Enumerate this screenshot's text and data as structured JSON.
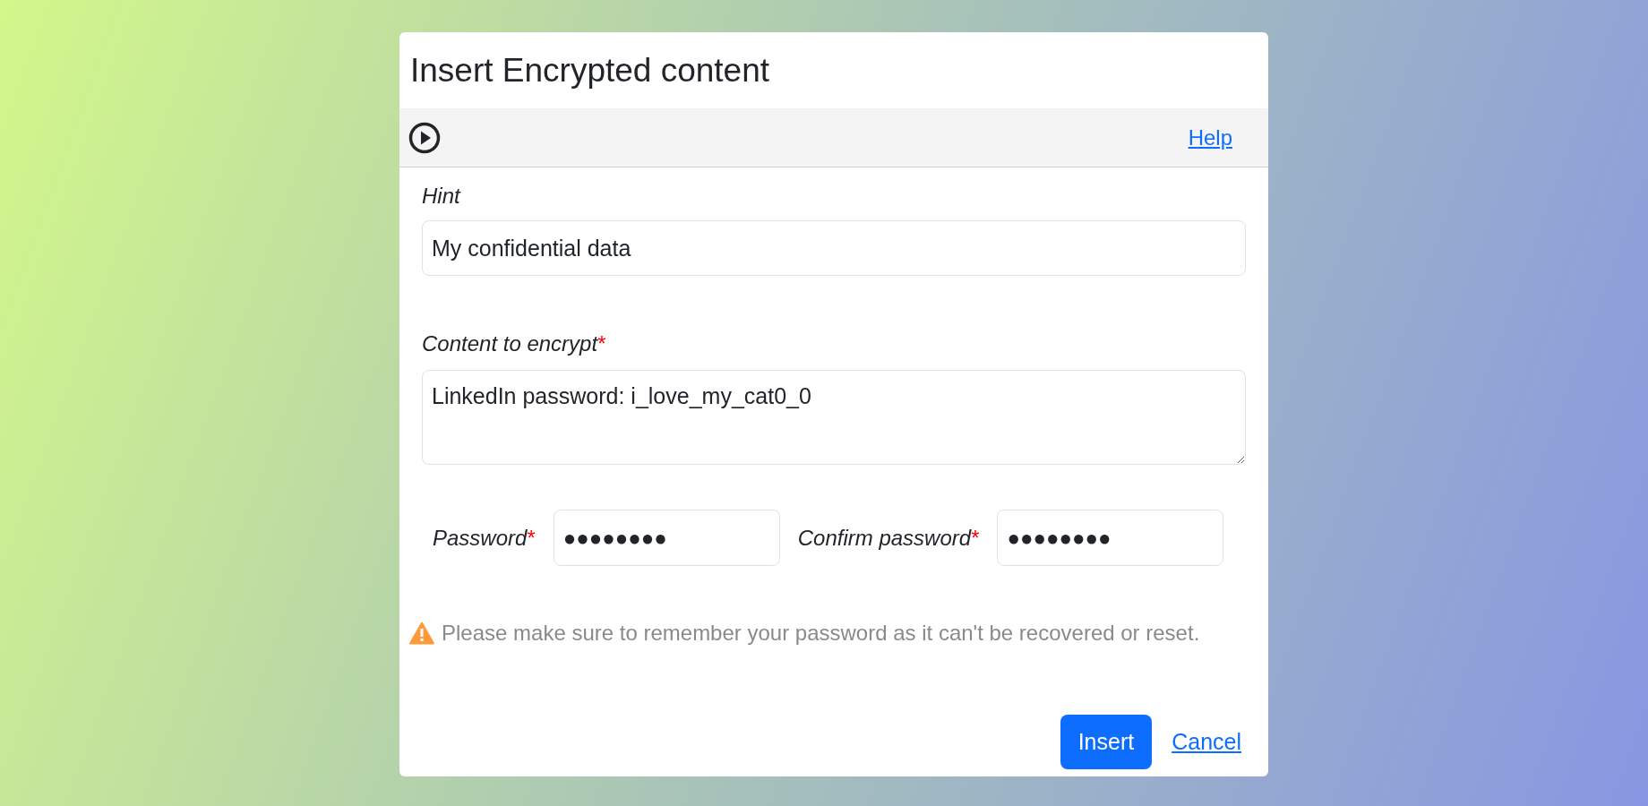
{
  "dialog": {
    "title": "Insert Encrypted content"
  },
  "toolbar": {
    "help_link": "Help"
  },
  "hint": {
    "label": "Hint",
    "value": "My confidential data"
  },
  "content": {
    "label": "Content to encrypt",
    "required_mark": "*",
    "value": "LinkedIn password: i_love_my_cat0_0"
  },
  "password_fields": [
    {
      "label": "Password",
      "required_mark": "*",
      "value": "●●●●●●●●"
    },
    {
      "label": "Confirm password",
      "required_mark": "*",
      "value": "●●●●●●●●"
    }
  ],
  "warning": "Please make sure to remember your password as it can't be recovered or reset.",
  "buttons": {
    "insert": "Insert",
    "cancel": "Cancel"
  }
}
